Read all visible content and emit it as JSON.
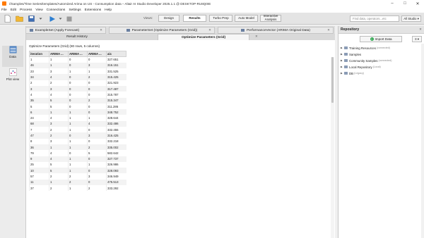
{
  "window": {
    "title": "//Samples/Time Series/templates/Automized Arima on US - Consumption data – Altair AI Studio Developer 2025.1.1 @ DESKTOP-RU8Q0IE",
    "minimize": "–",
    "maximize": "□",
    "close": "✕"
  },
  "menu": [
    "File",
    "Edit",
    "Process",
    "View",
    "Connections",
    "Settings",
    "Extensions",
    "Help"
  ],
  "toolbar": {
    "views_label": "Views:",
    "views": [
      "Design",
      "Results",
      "Turbo Prep",
      "Auto Model",
      "Interactive Analysis"
    ],
    "active_view": "Results",
    "search_placeholder": "Find data, operators...etc",
    "studio_label": "All Studio ▾"
  },
  "result_tabs": [
    {
      "label": "ExampleSet (Apply Forecast)"
    },
    {
      "label": "ParameterSet (Optimize Parameters (Grid))"
    },
    {
      "label": "PerformanceVector (ARIMA Original Data)"
    }
  ],
  "sub_tabs": [
    "Result History",
    "Optimize Parameters (Grid)"
  ],
  "active_sub_tab": "Optimize Parameters (Grid)",
  "left_nav": [
    {
      "label": "Data",
      "icon": "data-table-icon"
    },
    {
      "label": "Plot view",
      "icon": "plot-view-icon"
    }
  ],
  "table": {
    "title": "Optimize Parameters (Grid) (80 rows, 5 columns)",
    "columns": [
      "iteration",
      "ARIMA ...",
      "ARIMA ...",
      "ARIMA ...",
      "aic"
    ],
    "rows": [
      [
        "1",
        "1",
        "0",
        "0",
        "327.651"
      ],
      [
        "46",
        "1",
        "0",
        "3",
        "316.151"
      ],
      [
        "23",
        "3",
        "1",
        "1",
        "331.525"
      ],
      [
        "34",
        "4",
        "0",
        "2",
        "315.425"
      ],
      [
        "2",
        "2",
        "0",
        "0",
        "321.923"
      ],
      [
        "3",
        "3",
        "0",
        "0",
        "317.487"
      ],
      [
        "4",
        "4",
        "0",
        "0",
        "315.787"
      ],
      [
        "35",
        "5",
        "0",
        "2",
        "315.347"
      ],
      [
        "5",
        "5",
        "0",
        "0",
        "311.286"
      ],
      [
        "6",
        "1",
        "1",
        "0",
        "348.752"
      ],
      [
        "24",
        "4",
        "1",
        "1",
        "328.644"
      ],
      [
        "68",
        "3",
        "1",
        "4",
        "332.486"
      ],
      [
        "7",
        "2",
        "1",
        "0",
        "332.455"
      ],
      [
        "47",
        "2",
        "0",
        "3",
        "316.425"
      ],
      [
        "8",
        "3",
        "1",
        "0",
        "332.218"
      ],
      [
        "36",
        "1",
        "1",
        "2",
        "335.002"
      ],
      [
        "79",
        "4",
        "0",
        "5",
        "582.642"
      ],
      [
        "9",
        "4",
        "1",
        "0",
        "327.737"
      ],
      [
        "25",
        "5",
        "1",
        "1",
        "326.986"
      ],
      [
        "10",
        "5",
        "1",
        "0",
        "328.093"
      ],
      [
        "57",
        "2",
        "2",
        "3",
        "346.949"
      ],
      [
        "11",
        "1",
        "2",
        "0",
        "475.513"
      ],
      [
        "37",
        "2",
        "1",
        "2",
        "333.292"
      ]
    ]
  },
  "repository": {
    "title": "Repository",
    "close": "✕",
    "import_label": "Import Data",
    "menu_label": "≡ ▾",
    "items": [
      {
        "label": "Training Resources",
        "sub": "(connected)"
      },
      {
        "label": "Samples",
        "sub": ""
      },
      {
        "label": "Community Samples",
        "sub": "(connected)"
      },
      {
        "label": "Local Repository",
        "sub": "(Local)"
      },
      {
        "label": "DB",
        "sub": "(Legacy)"
      }
    ]
  }
}
